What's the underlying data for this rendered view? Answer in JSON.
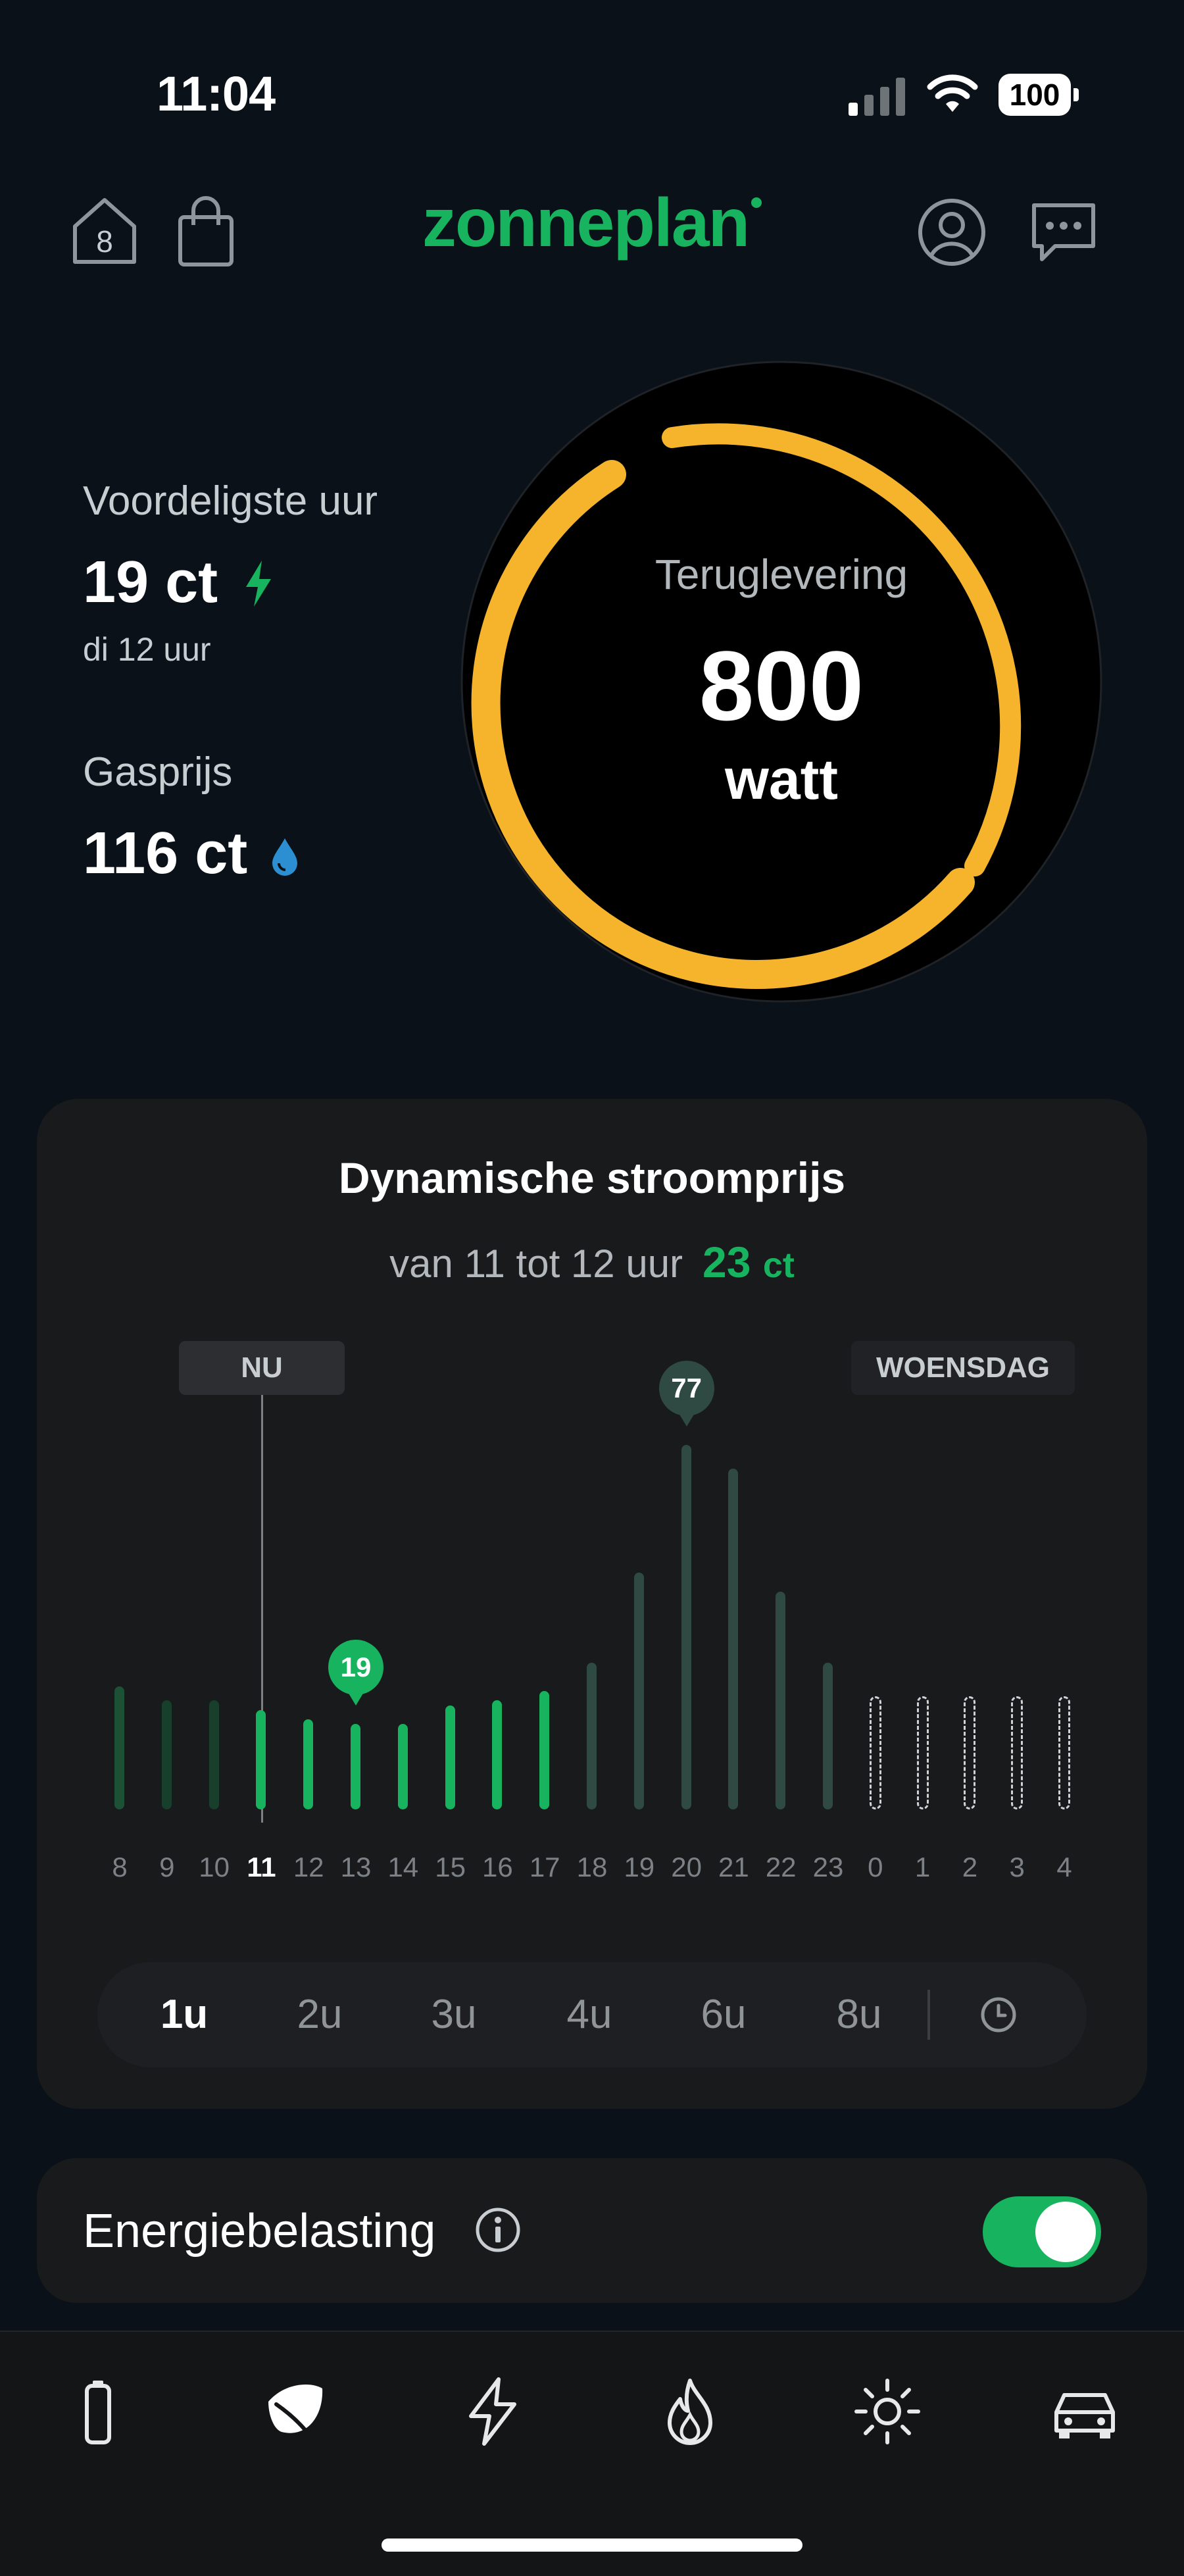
{
  "status_bar": {
    "time": "11:04",
    "battery": "100"
  },
  "header": {
    "house_badge": "8",
    "logo_text": "zonneplan"
  },
  "cheapest_hour": {
    "label": "Voordeligste uur",
    "price": "19 ct",
    "when": "di 12 uur"
  },
  "gas": {
    "label": "Gasprijs",
    "price": "116 ct"
  },
  "gauge": {
    "label": "Teruglevering",
    "value": "800",
    "unit": "watt"
  },
  "price_card": {
    "title": "Dynamische stroomprijs",
    "range_text": "van 11 tot 12 uur",
    "current_price": "23",
    "current_unit": "ct",
    "now_label": "NU",
    "day_label": "WOENSDAG",
    "low_pin": "19",
    "high_pin": "77"
  },
  "chart_data": {
    "type": "bar",
    "categories": [
      "8",
      "9",
      "10",
      "11",
      "12",
      "13",
      "14",
      "15",
      "16",
      "17",
      "18",
      "19",
      "20",
      "21",
      "22",
      "23",
      "0",
      "1",
      "2",
      "3",
      "4"
    ],
    "values": [
      26,
      23,
      23,
      21,
      19,
      18,
      18,
      22,
      23,
      25,
      31,
      50,
      77,
      72,
      46,
      31,
      23,
      23,
      23,
      23,
      23
    ],
    "current_category": "11",
    "future_unknown_categories": [
      "0",
      "1",
      "2",
      "3",
      "4"
    ]
  },
  "segments": {
    "items": [
      "1u",
      "2u",
      "3u",
      "4u",
      "6u",
      "8u"
    ],
    "active": "1u"
  },
  "energy_tax": {
    "label": "Energiebelasting",
    "enabled": true
  },
  "tabbar": {
    "items": [
      "battery-icon",
      "leaf-icon",
      "bolt-icon",
      "flame-icon",
      "sun-icon",
      "car-icon"
    ]
  },
  "colors": {
    "accent": "#17b35f",
    "gauge": "#f6b42c",
    "background": "#0b1118",
    "card": "#191a1c"
  }
}
